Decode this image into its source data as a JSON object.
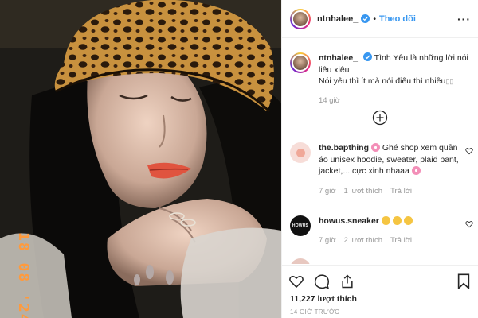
{
  "photo": {
    "timestamp_overlay": "18 08 '24"
  },
  "header": {
    "username": "ntnhalee_",
    "follow_label": "Theo dõi",
    "more_icon": "more-horizontal-icon"
  },
  "caption": {
    "username": "ntnhalee_",
    "text_line1": "Tình Yêu là những lời nói liêu xiêu",
    "text_line2": "Nói yêu thì ít mà nói điêu thì nhiều",
    "time": "14 giờ"
  },
  "add_comment_icon": "plus-circle-icon",
  "comments": [
    {
      "username": "the.bapthing",
      "text": "Ghé shop xem quần áo unisex hoodie, sweater, plaid pant, jacket,... cực xinh nhaaa",
      "time": "7 giờ",
      "likes": "1 lượt thích",
      "reply": "Trả lời"
    },
    {
      "username": "howus.sneaker",
      "text": "",
      "time": "7 giờ",
      "likes": "2 lượt thích",
      "reply": "Trả lời",
      "avatar_text": "HOWUS"
    }
  ],
  "actions": {
    "likes": "11,227 lượt thích",
    "posted": "14 GIỜ TRƯỚC"
  },
  "colors": {
    "accent": "#3897f0",
    "muted": "#999999",
    "border": "#efefef"
  }
}
